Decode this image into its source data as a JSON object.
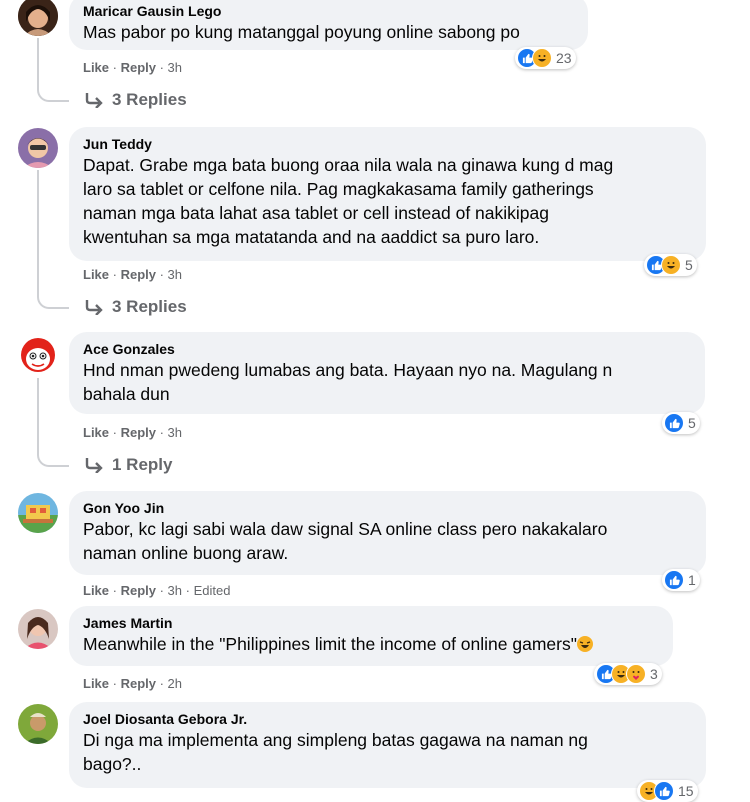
{
  "comments": [
    {
      "author": "Maricar Gausin Lego",
      "text": "Mas pabor po kung matanggal poyung online sabong po",
      "like": "Like",
      "reply": "Reply",
      "time": "3h",
      "edited": "",
      "reaction_count": "23",
      "replies": "3 Replies"
    },
    {
      "author": "Jun Teddy",
      "text_lines": [
        "Dapat. Grabe mga bata buong oraa nila wala na ginawa kung d mag",
        "laro sa tablet or celfone nila. Pag magkakasama family gatherings",
        "naman mga bata lahat asa tablet or cell instead of nakikipag",
        "kwentuhan sa mga matatanda and na aaddict sa puro laro."
      ],
      "like": "Like",
      "reply": "Reply",
      "time": "3h",
      "reaction_count": "5",
      "replies": "3 Replies"
    },
    {
      "author": "Ace Gonzales",
      "text_lines": [
        "Hnd nman pwedeng lumabas ang bata. Hayaan nyo na. Magulang n",
        "bahala dun"
      ],
      "like": "Like",
      "reply": "Reply",
      "time": "3h",
      "reaction_count": "5",
      "replies": "1 Reply"
    },
    {
      "author": "Gon Yoo Jin",
      "text_lines": [
        "Pabor, kc lagi sabi wala daw signal SA online class pero nakakalaro",
        "naman online buong araw."
      ],
      "like": "Like",
      "reply": "Reply",
      "time": "3h",
      "edited": "Edited",
      "reaction_count": "1"
    },
    {
      "author": "James Martin",
      "text": "Meanwhile in the \"Philippines limit the income of online gamers\"",
      "like": "Like",
      "reply": "Reply",
      "time": "2h",
      "reaction_count": "3"
    },
    {
      "author": "Joel Diosanta Gebora Jr.",
      "text_lines": [
        "Di nga ma implementa ang simpleng batas gagawa na naman ng",
        "bago?.."
      ],
      "reaction_count": "15"
    }
  ],
  "colors": {
    "bubble": "#f0f2f5",
    "like_blue": "#1877f2",
    "haha_yellow": "#f7b125",
    "meta_gray": "#65676b"
  },
  "icons": {
    "reply_arrow": "reply-arrow-icon",
    "like": "like-reaction-icon",
    "haha": "haha-reaction-icon"
  }
}
